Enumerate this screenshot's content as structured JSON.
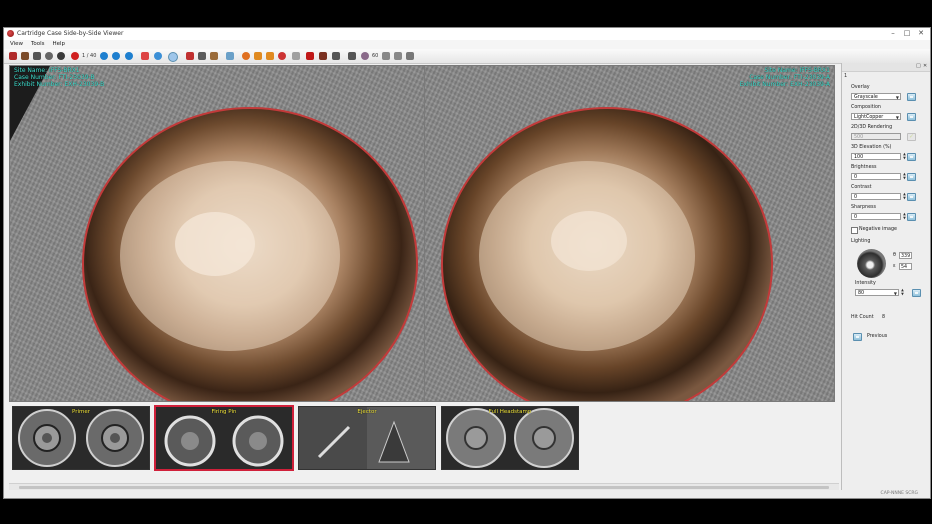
{
  "window": {
    "title": "Cartridge Case Side-by-Side Viewer",
    "minimize": "–",
    "maximize": "□",
    "close": "✕"
  },
  "menu": [
    "View",
    "Tools",
    "Help"
  ],
  "toolbar": {
    "page_counter": "1 / 40",
    "zoom_label": "60"
  },
  "left_pane": {
    "site_name": "Site Name: IFFS-BRX1",
    "case_number": "Case Number: FTI-23039-B",
    "exhibit_number": "Exhibit Number: EXH-23039-B"
  },
  "right_pane": {
    "site_name": "Site Name: IFFS-BRX1",
    "case_number": "Case Number: FTI-23039-A",
    "exhibit_number": "Exhibit Number: EXH-23039-A"
  },
  "side_panel": {
    "tab_label": "1",
    "overlay": {
      "label": "Overlay",
      "value": "Grayscale"
    },
    "composition": {
      "label": "Composition",
      "value": "LightCopper"
    },
    "rendering": {
      "label": "2D/3D Rendering",
      "value": "500"
    },
    "elevation": {
      "label": "3D Elevation (%)",
      "value": "100"
    },
    "brightness": {
      "label": "Brightness",
      "value": "0"
    },
    "contrast": {
      "label": "Contrast",
      "value": "0"
    },
    "sharpness": {
      "label": "Sharpness",
      "value": "0"
    },
    "negative_image": {
      "label": "Negative image"
    },
    "lighting": {
      "label": "Lighting",
      "angle_symbol": "θ",
      "angle_value": "339",
      "elevation_symbol": "ε",
      "elevation_value": "54"
    },
    "intensity": {
      "label": "Intensity",
      "value": "80"
    },
    "hit_count": {
      "label": "Hit Count",
      "value": "8"
    },
    "previous_button": "Previous"
  },
  "thumbnails": [
    {
      "label": "Primer",
      "selected": false
    },
    {
      "label": "Firing Pin",
      "selected": true
    },
    {
      "label": "Ejector",
      "selected": false
    },
    {
      "label": "Full Headstamp",
      "selected": false
    }
  ],
  "status": {
    "text": "CAP-NNNE SCRG"
  },
  "colors": {
    "overlay_text": "#3ee0d0",
    "selection_border": "#d0203a",
    "thumb_label": "#f0e33a",
    "ring": "#c23a3a"
  }
}
